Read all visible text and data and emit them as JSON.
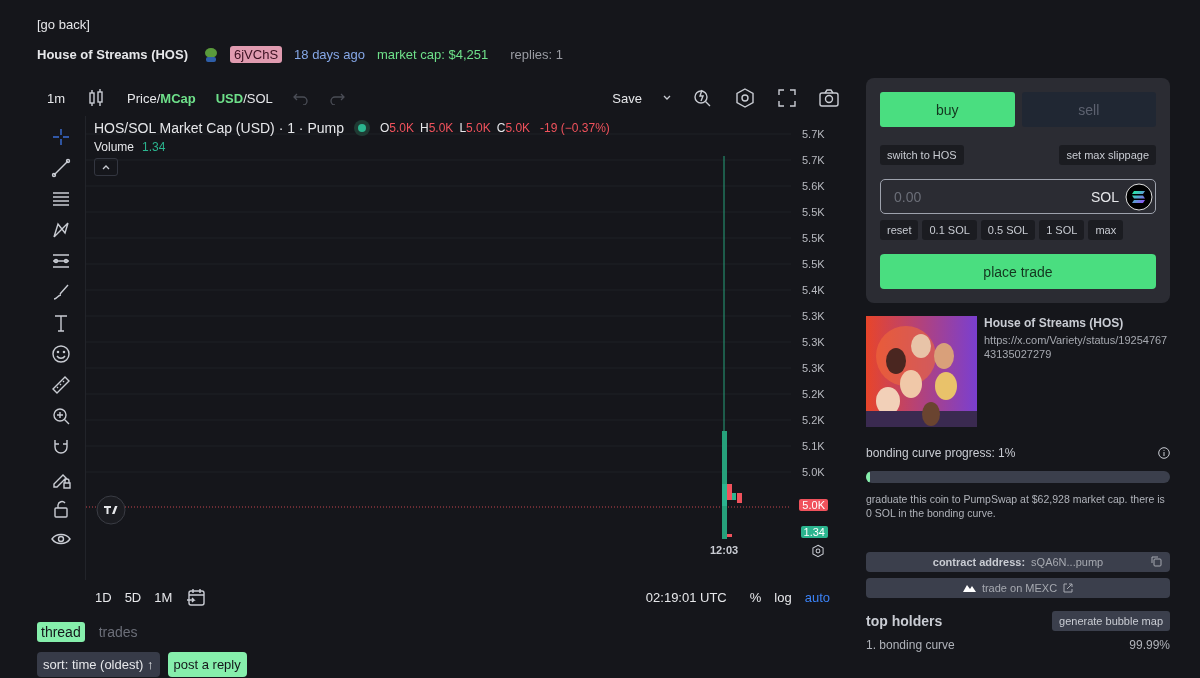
{
  "back_link": "[go back]",
  "header": {
    "name": "House of Streams (HOS)",
    "creator": "6jVChS",
    "age": "18 days ago",
    "market_cap": "market cap: $4,251",
    "replies": "replies: 1"
  },
  "chart_toolbar": {
    "interval": "1m",
    "price_toggle": {
      "separator": "/",
      "parts": [
        {
          "label": "Price",
          "selected": false
        },
        {
          "label": "MCap",
          "selected": true
        }
      ]
    },
    "currency_toggle": {
      "separator": "/",
      "parts": [
        {
          "label": "USD",
          "selected": true
        },
        {
          "label": "SOL",
          "selected": false
        }
      ]
    },
    "save": "Save"
  },
  "legend": {
    "title": "HOS/SOL Market Cap (USD) · 1 · Pump",
    "ohlc": [
      {
        "key": "O",
        "value": "5.0K"
      },
      {
        "key": "H",
        "value": "5.0K"
      },
      {
        "key": "L",
        "value": "5.0K"
      },
      {
        "key": "C",
        "value": "5.0K"
      }
    ],
    "change": "-19 (−0.37%)",
    "volume_label": "Volume",
    "volume_value": "1.34"
  },
  "price_axis": [
    "5.7K",
    "5.7K",
    "5.6K",
    "5.5K",
    "5.5K",
    "5.5K",
    "5.4K",
    "5.3K",
    "5.3K",
    "5.3K",
    "5.2K",
    "5.2K",
    "5.1K",
    "5.0K"
  ],
  "last_price": "5.0K",
  "last_volume": "1.34",
  "time_label": "12:03",
  "ranges": [
    "1D",
    "5D",
    "1M"
  ],
  "clock": "02:19:01 UTC",
  "scale_options": [
    {
      "label": "%",
      "on": false
    },
    {
      "label": "log",
      "on": false
    },
    {
      "label": "auto",
      "on": true
    }
  ],
  "tabs": [
    {
      "label": "thread",
      "selected": true
    },
    {
      "label": "trades",
      "selected": false
    }
  ],
  "thread_controls": {
    "sort": "sort: time (oldest) ↑",
    "post": "post a reply"
  },
  "trade": {
    "sides": [
      {
        "label": "buy",
        "selected": true
      },
      {
        "label": "sell",
        "selected": false
      }
    ],
    "switch": "switch to HOS",
    "slippage": "set max slippage",
    "amount_placeholder": "0.00",
    "currency": "SOL",
    "presets": [
      "reset",
      "0.1 SOL",
      "0.5 SOL",
      "1 SOL",
      "max"
    ],
    "submit": "place trade"
  },
  "coin": {
    "kind": "picture",
    "name": "House of Streams (HOS)",
    "link": "https://x.com/Variety/status/1925476743135027279"
  },
  "bonding": {
    "label": "bonding curve progress: 1%",
    "level": 0.01,
    "note": "graduate this coin to PumpSwap at $62,928 market cap. there is 0 SOL in the bonding curve."
  },
  "contract": {
    "label": "contract address:",
    "value": "sQA6N...pump"
  },
  "mexc": "trade on MEXC",
  "holders": {
    "title": "top holders",
    "button": "generate bubble map",
    "rows": [
      {
        "name": "1. bonding curve",
        "share": "99.99%"
      }
    ]
  }
}
